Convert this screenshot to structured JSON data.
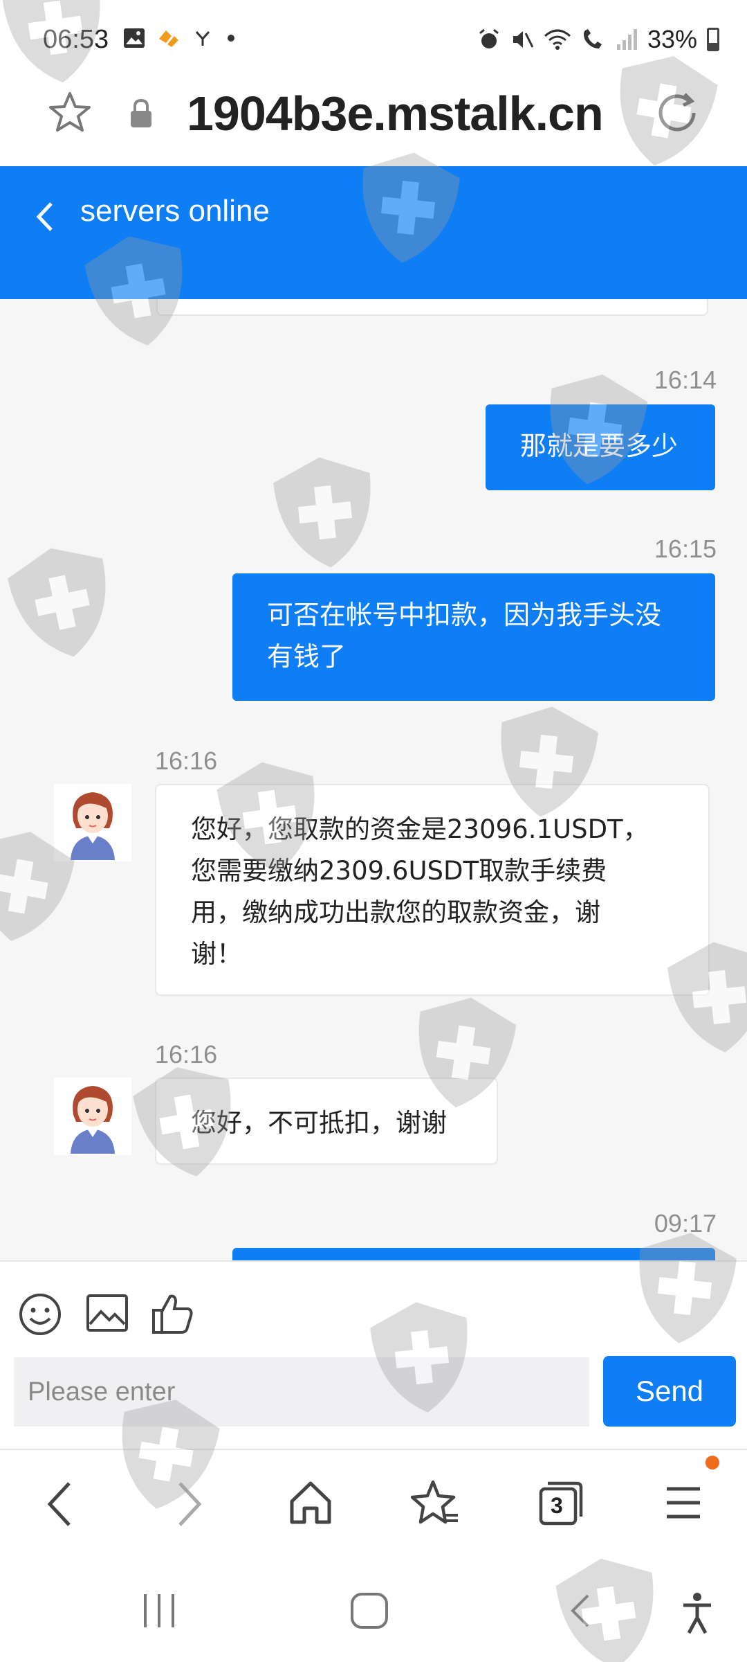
{
  "status_bar": {
    "time": "06:53",
    "battery": "33%"
  },
  "url_bar": {
    "url": "1904b3e.mstalk.cn"
  },
  "header": {
    "title": "servers online"
  },
  "messages": [
    {
      "direction": "out",
      "time": "16:14",
      "text": "那就是要多少"
    },
    {
      "direction": "out",
      "time": "16:15",
      "text_lines": [
        "可否在帐号中扣款，因为我手头没",
        "有钱了"
      ]
    },
    {
      "direction": "in",
      "time": "16:16",
      "text_lines": [
        "您好，您取款的资金是23096.1USDT，",
        "您需要缴纳2309.6USDT取款手续费",
        "用，缴纳成功出款您的取款资金，谢",
        "谢！"
      ]
    },
    {
      "direction": "in",
      "time": "16:16",
      "text": "您好，不可抵扣，谢谢"
    },
    {
      "direction": "out",
      "time": "09:17",
      "text": ""
    }
  ],
  "composer": {
    "placeholder": "Please enter",
    "send_label": "Send"
  },
  "browser_nav": {
    "tabs_count": "3"
  },
  "colors": {
    "accent": "#0f7ef4",
    "badge": "#f26b1d"
  },
  "icons": [
    "star-icon",
    "lock-icon",
    "reload-icon",
    "back-chevron-icon",
    "emoji-icon",
    "image-icon",
    "thumbs-up-icon",
    "back-arrow-icon",
    "forward-arrow-icon",
    "home-icon",
    "bookmarks-icon",
    "tabs-icon",
    "menu-icon",
    "recents-icon",
    "home-button-icon",
    "system-back-icon",
    "accessibility-icon",
    "shield-watermark-icon"
  ]
}
